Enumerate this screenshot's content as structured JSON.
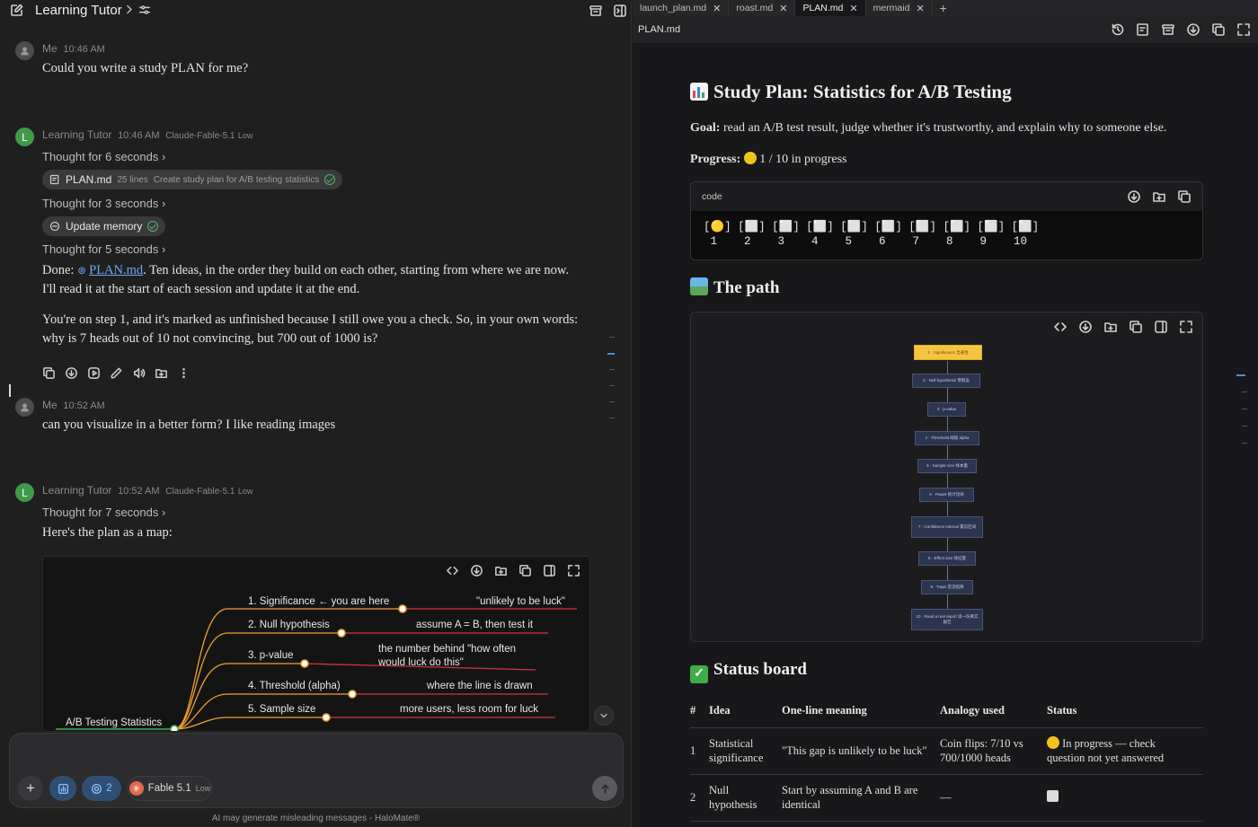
{
  "chat": {
    "title": "Learning Tutor",
    "messages": [
      {
        "sender": "Me",
        "time": "10:46 AM",
        "text": "Could you write a study PLAN for me?"
      },
      {
        "sender": "Learning Tutor",
        "time": "10:46 AM",
        "model": "Claude-Fable-5.1",
        "level": "Low"
      },
      {
        "sender": "Me",
        "time": "10:52 AM",
        "text": "can you visualize in a better form? I like reading images"
      },
      {
        "sender": "Learning Tutor",
        "time": "10:52 AM",
        "model": "Claude-Fable-5.1",
        "level": "Low"
      }
    ],
    "thought1": "Thought for 6 seconds",
    "thought2": "Thought for 3 seconds",
    "thought3": "Thought for 5 seconds",
    "thought4": "Thought for 7 seconds",
    "file_chip": {
      "name": "PLAN.md",
      "lines": "25 lines",
      "desc": "Create study plan for A/B testing statistics"
    },
    "memory_chip": "Update memory",
    "done_prefix": "Done: ",
    "done_link": "PLAN.md",
    "done_rest": ". Ten ideas, in the order they build on each other, starting from where we are now.",
    "done_line2": "I'll read it at the start of each session and update it at the end.",
    "step_line1": "You're on step 1, and it's marked as unfinished because I still owe you a check. So, in your own words:",
    "step_line2": "why is 7 heads out of 10 not convincing, but 700 out of 1000 is?",
    "map_intro": "Here's the plan as a map:"
  },
  "mindmap": {
    "root": "A/B Testing Statistics",
    "branches": [
      {
        "label": "1. Significance ← you are here",
        "note": "\"unlikely to be luck\""
      },
      {
        "label": "2. Null hypothesis",
        "note": "assume A = B, then test it"
      },
      {
        "label": "3. p-value",
        "note1": "the number behind \"how often",
        "note2": "would luck do this\""
      },
      {
        "label": "4. Threshold (alpha)",
        "note": "where the line is drawn"
      },
      {
        "label": "5. Sample size",
        "note": "more users, less room for luck"
      }
    ]
  },
  "composer": {
    "context_count": "2",
    "model": "Fable 5.1",
    "model_level": "Low",
    "disclaimer": "AI may generate misleading messages - HaloMate®"
  },
  "editor": {
    "tabs": [
      "launch_plan.md",
      "roast.md",
      "PLAN.md",
      "mermaid"
    ],
    "active_tab": "PLAN.md",
    "path": "PLAN.md",
    "h1": "Study Plan: Statistics for A/B Testing",
    "goal_label": "Goal:",
    "goal_text": " read an A/B test result, judge whether it's trustworthy, and explain why to someone else.",
    "progress_label": "Progress:",
    "progress_text": " 1 / 10 in progress",
    "code_lang": "code",
    "code_line1": "[🟡] [⬜] [⬜] [⬜] [⬜] [⬜] [⬜] [⬜] [⬜] [⬜]",
    "code_line2": " 1    2    3    4    5    6    7    8    9    10",
    "h2_path": "The path",
    "flow_nodes": [
      "1 · Significance 显著性",
      "2 · Null hypothesis 零假设",
      "3 · p-value",
      "4 · Threshold 阈值 alpha",
      "5 · Sample size 样本量",
      "6 · Power 统计功效",
      "7 · Confidence interval 置信区间",
      "8 · Effect size 效应量",
      "9 · Traps 常见陷阱",
      "10 · Read a real report 读一份真实报告"
    ],
    "h2_status": "Status board",
    "table_headers": [
      "#",
      "Idea",
      "One-line meaning",
      "Analogy used",
      "Status"
    ],
    "rows": [
      {
        "n": "1",
        "idea1": "Statistical",
        "idea2": "significance",
        "meaning": "\"This gap is unlikely to be luck\"",
        "analogy1": "Coin flips: 7/10 vs",
        "analogy2": "700/1000 heads",
        "status1": " In progress — check",
        "status2": "question not yet answered"
      },
      {
        "n": "2",
        "idea1": "Null",
        "idea2": "hypothesis",
        "meaning1": "Start by assuming A and B are",
        "meaning2": "identical",
        "analogy": "—"
      }
    ]
  },
  "colors": {
    "accent": "#6aa8f0",
    "avatar_bot": "#3f9a48",
    "highlight_node": "#f5c542",
    "mindmap_branch": "#f0a030",
    "mindmap_line": "#d0343c"
  }
}
